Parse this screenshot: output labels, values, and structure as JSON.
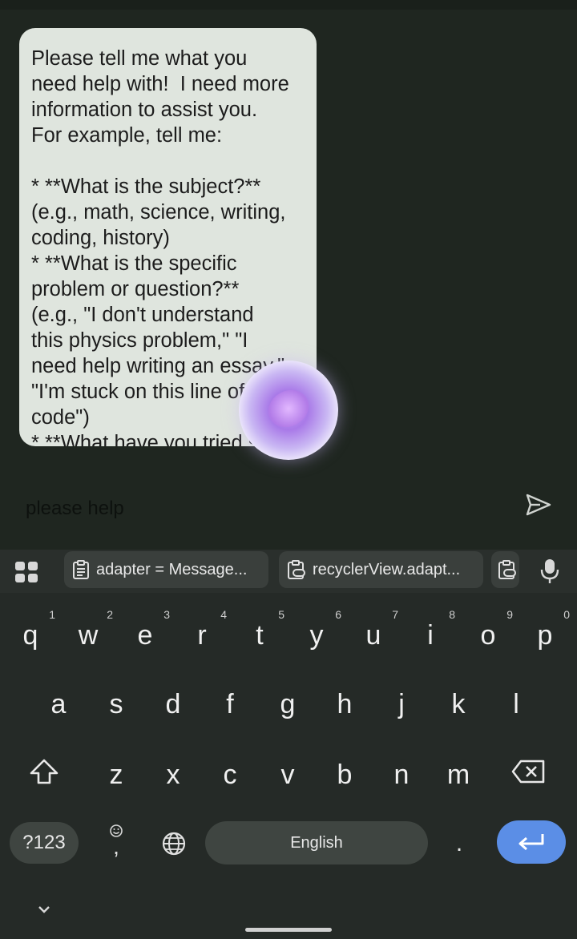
{
  "chat": {
    "message": "Please tell me what you\nneed help with!  I need more\ninformation to assist you.\nFor example, tell me:\n\n* **What is the subject?**\n(e.g., math, science, writing,\ncoding, history)\n* **What is the specific\nproblem or question?**\n(e.g., \"I don't understand\nthis physics problem,\" \"I\nneed help writing an essay,\"\n\"I'm stuck on this line of\ncode\")\n* **What have you tried so far?**"
  },
  "input": {
    "value": "please help",
    "placeholder": ""
  },
  "suggestions": {
    "chip1": "adapter = Message...",
    "chip2": "recyclerView.adapt..."
  },
  "keyboard": {
    "row1": [
      {
        "key": "q",
        "hint": "1"
      },
      {
        "key": "w",
        "hint": "2"
      },
      {
        "key": "e",
        "hint": "3"
      },
      {
        "key": "r",
        "hint": "4"
      },
      {
        "key": "t",
        "hint": "5"
      },
      {
        "key": "y",
        "hint": "6"
      },
      {
        "key": "u",
        "hint": "7"
      },
      {
        "key": "i",
        "hint": "8"
      },
      {
        "key": "o",
        "hint": "9"
      },
      {
        "key": "p",
        "hint": "0"
      }
    ],
    "row2": [
      "a",
      "s",
      "d",
      "f",
      "g",
      "h",
      "j",
      "k",
      "l"
    ],
    "row3": [
      "z",
      "x",
      "c",
      "v",
      "b",
      "n",
      "m"
    ],
    "mode_label": "?123",
    "space_label": "English",
    "period_label": ".",
    "emoji_comma": ","
  },
  "colors": {
    "accent": "#5b8ee6",
    "bubble": "#dfe5de"
  }
}
